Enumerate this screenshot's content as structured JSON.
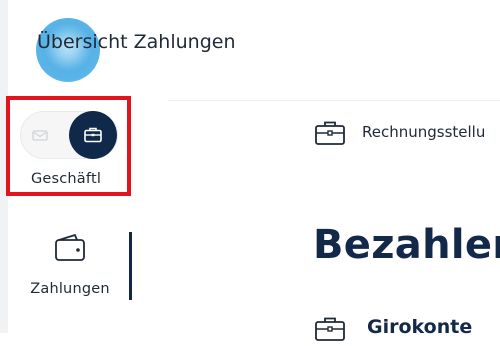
{
  "sidebar": {
    "mode_toggle": {
      "selected_label": "Geschäftl",
      "icon_private": "envelope-icon",
      "icon_business": "briefcase-icon"
    },
    "nav": [
      {
        "label": "Zahlungen",
        "icon": "wallet-icon",
        "active": true
      }
    ]
  },
  "main": {
    "title": "Übersicht Zahlungen",
    "quick_action": {
      "label": "Rechnungsstellu",
      "icon": "briefcase-icon"
    },
    "section_heading": "Bezahler",
    "account_row": {
      "label": "Girokonte",
      "icon": "briefcase-icon"
    }
  },
  "colors": {
    "brand_navy": "#10294a",
    "highlight_red": "#e3141b",
    "avatar_blue": "#57b2e6"
  }
}
